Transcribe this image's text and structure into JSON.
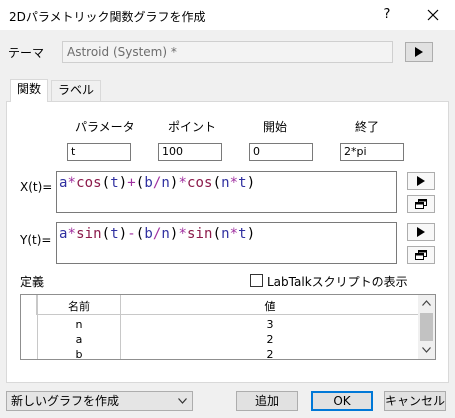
{
  "window": {
    "title": "2Dパラメトリック関数グラフを作成",
    "help": "?"
  },
  "theme": {
    "label": "テーマ",
    "value": "Astroid (System) *"
  },
  "tabs": [
    {
      "label": "関数"
    },
    {
      "label": "ラベル"
    }
  ],
  "params": {
    "headers": [
      "パラメータ",
      "ポイント",
      "開始",
      "終了"
    ],
    "values": [
      "t",
      "100",
      "0",
      "2*pi"
    ]
  },
  "x_expr": {
    "label": "X(t)=",
    "value": "a*cos(t)+(b/n)*cos(n*t)"
  },
  "y_expr": {
    "label": "Y(t)=",
    "value": "a*sin(t)-(b/n)*sin(n*t)"
  },
  "definitions": {
    "label": "定義",
    "show_labtalk": "LabTalkスクリプトの表示",
    "columns": [
      "名前",
      "値"
    ],
    "rows": [
      [
        "n",
        "3"
      ],
      [
        "a",
        "2"
      ],
      [
        "b",
        "2"
      ]
    ]
  },
  "footer": {
    "mode": "新しいグラフを作成",
    "add": "追加",
    "ok": "OK",
    "cancel": "キャンセル"
  },
  "icons": [
    "close-icon",
    "play-arrow-icon",
    "copy-window-icon",
    "chevron-down-icon"
  ]
}
